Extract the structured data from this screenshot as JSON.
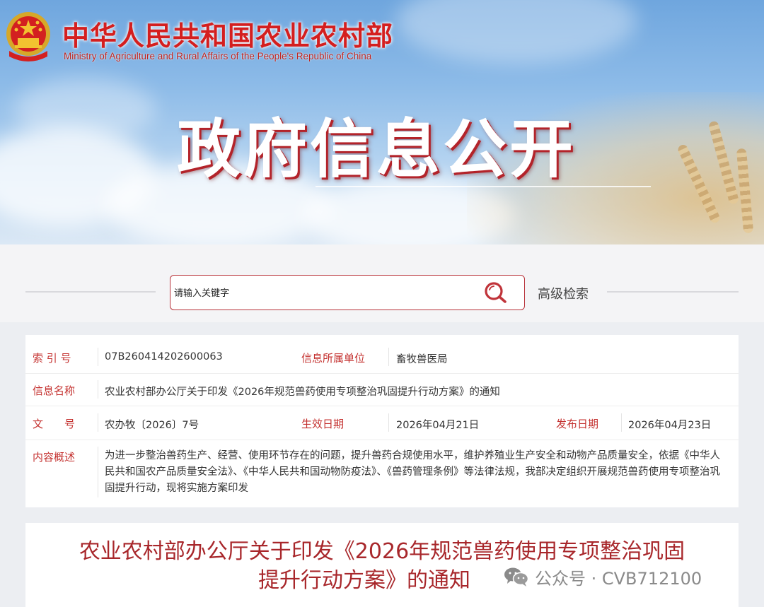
{
  "header": {
    "ministry_cn": "中华人民共和国农业农村部",
    "ministry_en": "Ministry of Agriculture and Rural Affairs of the People's Republic of China",
    "banner_title": "政府信息公开"
  },
  "search": {
    "placeholder": "请输入关键字",
    "advanced_label": "高级检索",
    "icon": "search-icon"
  },
  "info": {
    "index_label": "索 引 号",
    "index_value": "07B260414202600063",
    "unit_label": "信息所属单位",
    "unit_value": "畜牧兽医局",
    "name_label": "信息名称",
    "name_value": "农业农村部办公厅关于印发《2026年规范兽药使用专项整治巩固提升行动方案》的通知",
    "docno_label": "文　　号",
    "docno_value": "农办牧〔2026〕7号",
    "effective_label": "生效日期",
    "effective_value": "2026年04月21日",
    "publish_label": "发布日期",
    "publish_value": "2026年04月23日",
    "summary_label": "内容概述",
    "summary_value": "为进一步整治兽药生产、经营、使用环节存在的问题，提升兽药合规使用水平，维护养殖业生产安全和动物产品质量安全，依据《中华人民共和国农产品质量安全法》、《中华人民共和国动物防疫法》、《兽药管理条例》等法律法规，我部决定组织开展规范兽药使用专项整治巩固提升行动，现将实施方案印发"
  },
  "document": {
    "title_line1": "农业农村部办公厅关于印发《2026年规范兽药使用专项整治巩固",
    "title_line2": "提升行动方案》的通知"
  },
  "watermark": {
    "text": "公众号 · CVB712100",
    "icon": "wechat-icon"
  },
  "colors": {
    "label_red": "#c4312f",
    "title_red": "#a8272b",
    "brand_red": "#d41f1f"
  }
}
